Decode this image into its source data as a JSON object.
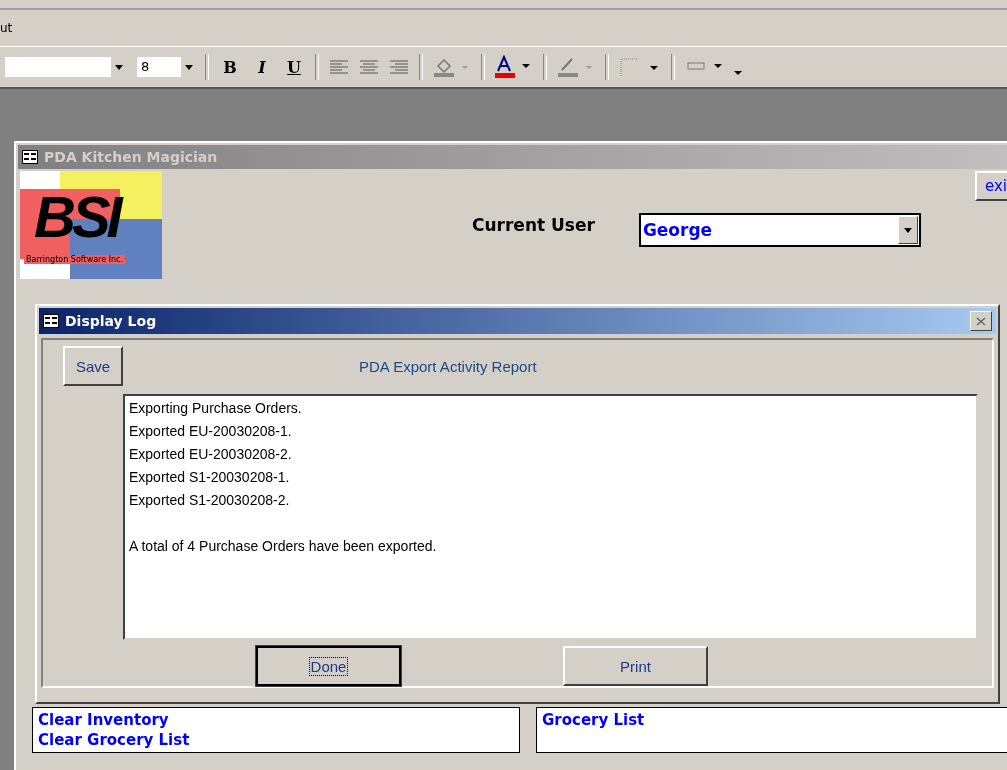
{
  "menu_bar": {
    "items": [
      "ut"
    ]
  },
  "toolbar": {
    "font_size": "8",
    "format_buttons": [
      {
        "label": "B",
        "kind": "bold"
      },
      {
        "label": "I",
        "kind": "italic"
      },
      {
        "label": "U",
        "kind": "underline"
      }
    ]
  },
  "main_window": {
    "title": "PDA Kitchen Magician",
    "logo": {
      "letters": "BSI",
      "caption": "Barrington Software Inc."
    },
    "current_user_label": "Current User",
    "current_user_value": "George",
    "exit_button": "exi",
    "left_list": [
      "Clear Inventory",
      "Clear Grocery List"
    ],
    "right_list": [
      "Grocery List"
    ]
  },
  "dialog": {
    "title": "Display Log",
    "save_button": "Save",
    "report_title": "PDA Export Activity Report",
    "log_paragraphs": [
      [
        "Exporting Purchase Orders.",
        "Exported EU-20030208-1.",
        "Exported EU-20030208-2.",
        "Exported S1-20030208-1.",
        "Exported S1-20030208-2."
      ],
      [
        "A total of 4 Purchase Orders have been exported."
      ]
    ],
    "buttons": [
      {
        "label": "Done",
        "focused": true
      },
      {
        "label": "Print",
        "focused": false
      }
    ]
  }
}
